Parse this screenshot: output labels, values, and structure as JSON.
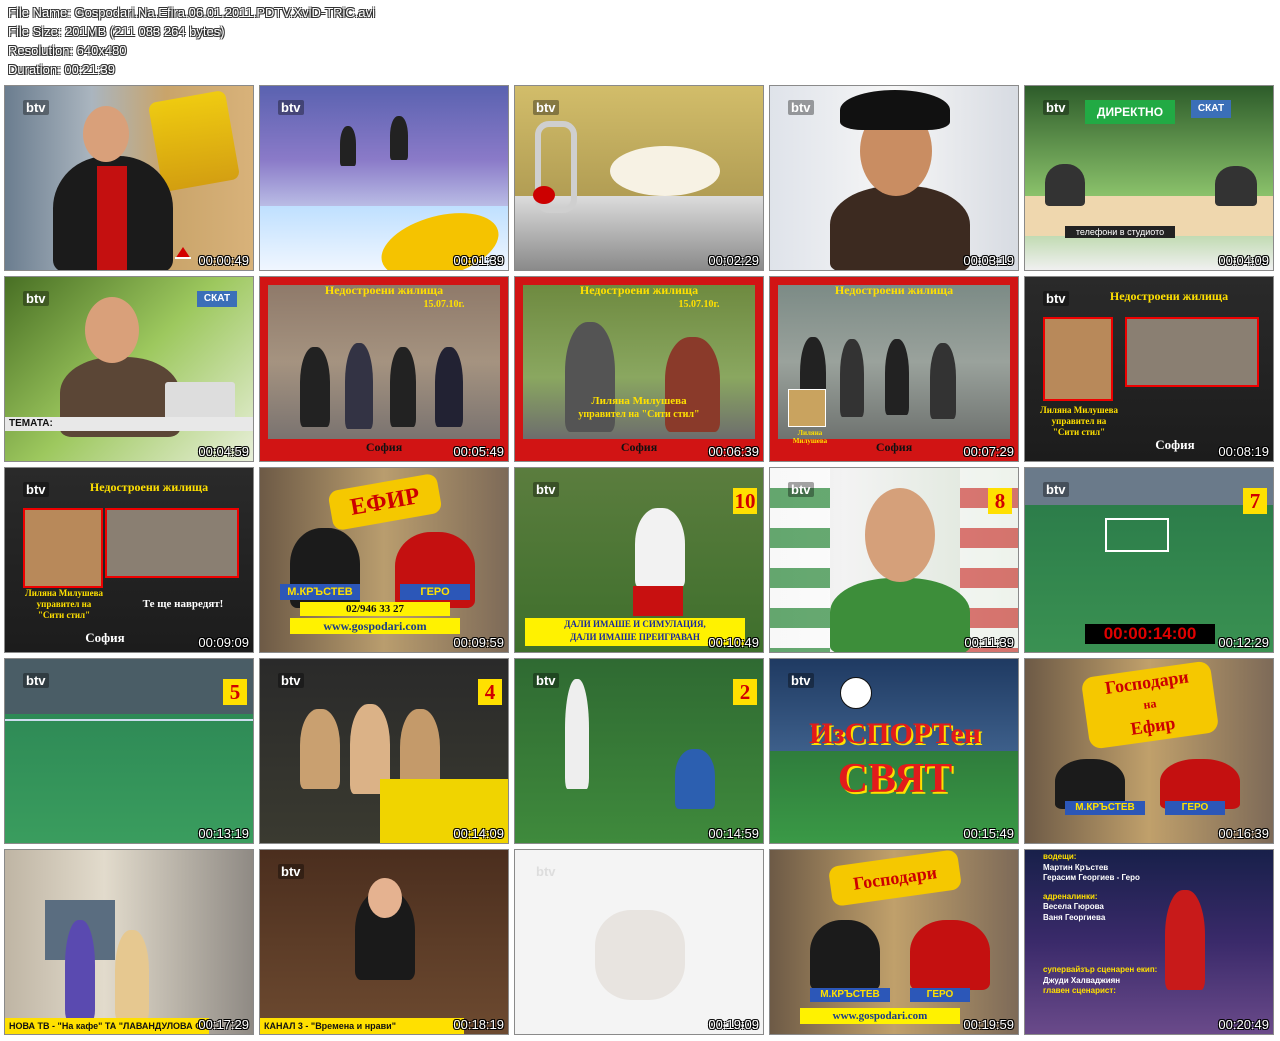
{
  "header": {
    "file_name": "File Name: Gospodari.Na.Efira.06.01.2011.PDTV.XviD-TRiC.avi",
    "file_size": "File Size: 201MB (211 083 264 bytes)",
    "resolution": "Resolution: 640x480",
    "duration": "Duration: 00:21:39"
  },
  "channel_bug": "btv",
  "thumbnails": [
    {
      "time": "00:00:49"
    },
    {
      "time": "00:01:39"
    },
    {
      "time": "00:02:29"
    },
    {
      "time": "00:03:19"
    },
    {
      "time": "00:04:09",
      "banner": "ДИРЕКТНО",
      "sub": "телефони в студиото",
      "badge": "СКАТ"
    },
    {
      "time": "00:04:59",
      "lower": "ТЕМАТА:",
      "badge": "СКАТ"
    },
    {
      "time": "00:05:49",
      "title": "Недостроени жилища",
      "date": "15.07.10г.",
      "place": "София"
    },
    {
      "time": "00:06:39",
      "title": "Недостроени жилища",
      "date": "15.07.10г.",
      "name": "Лиляна Милушева",
      "role": "управител на \"Сити стил\"",
      "place": "София"
    },
    {
      "time": "00:07:29",
      "title": "Недостроени жилища",
      "place": "София",
      "small": "Лиляна Милушева"
    },
    {
      "time": "00:08:19",
      "title": "Недостроени жилища",
      "name": "Лиляна Милушева",
      "role": "управител на",
      "role2": "\"Сити стил\"",
      "place": "София"
    },
    {
      "time": "00:09:09",
      "title": "Недостроени жилища",
      "name": "Лиляна Милушева",
      "role": "управител на",
      "role2": "\"Сити стил\"",
      "quote": "Те ще навредят!",
      "place": "София"
    },
    {
      "time": "00:09:59",
      "host1": "М.КРЪСТЕВ",
      "host2": "ГЕРО",
      "phone": "02/946 33 27",
      "web": "www.gospodari.com",
      "logo": "ЕФИР"
    },
    {
      "time": "00:10:49",
      "rank": "10",
      "cap1": "ДАЛИ ИМАШЕ И СИМУЛАЦИЯ,",
      "cap2": "ДАЛИ ИМАШЕ ПРЕИГРАВАН"
    },
    {
      "time": "00:11:39",
      "rank": "8"
    },
    {
      "time": "00:12:29",
      "rank": "7",
      "clock": "00:00:14:00"
    },
    {
      "time": "00:13:19",
      "rank": "5"
    },
    {
      "time": "00:14:09",
      "rank": "4"
    },
    {
      "time": "00:14:59",
      "rank": "2"
    },
    {
      "time": "00:15:49",
      "title1": "ИзСПОРТен",
      "title2": "СВЯТ"
    },
    {
      "time": "00:16:39",
      "host1": "М.КРЪСТЕВ",
      "host2": "ГЕРО",
      "logo1": "Господари",
      "logo2": "на",
      "logo3": "Ефир"
    },
    {
      "time": "00:17:29",
      "ticker": "НОВА ТВ - \"На кафе\" ТА \"ЛАВАНДУЛОВА ОМАЯ\""
    },
    {
      "time": "00:18:19",
      "ticker": "КАНАЛ 3 - \"Времена и нрави\""
    },
    {
      "time": "00:19:09"
    },
    {
      "time": "00:19:59",
      "host1": "М.КРЪСТЕВ",
      "host2": "ГЕРО",
      "web": "www.gospodari.com",
      "logo": "Господари"
    },
    {
      "time": "00:20:49",
      "credits": [
        "водещи:",
        "Мартин Кръстев",
        "Герасим Георгиев - Геро",
        "адреналинки:",
        "Весела Гюрова",
        "Ваня Георгиева",
        "супервайзър сценарен екип:",
        "Джуди Халваджиян",
        "главен сценарист:"
      ]
    }
  ],
  "colors": {
    "red_frame": "#d11414",
    "caption_yellow": "#ffe000",
    "sport_red": "#e11b1b",
    "clock_red": "#e00000"
  }
}
